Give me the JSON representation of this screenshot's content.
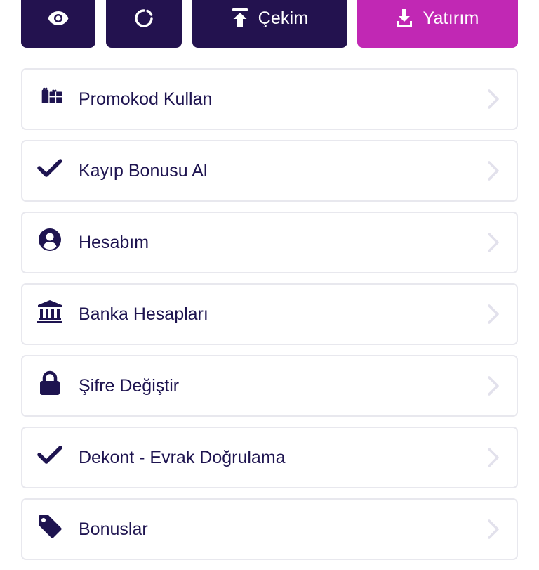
{
  "colors": {
    "dark_button": "#23124f",
    "accent_button": "#c128b4",
    "text": "#1e1450",
    "chevron": "#e2e1ec",
    "card_border": "#e8e8ee"
  },
  "toolbar": {
    "show_balance_icon": "eye-icon",
    "refresh_icon": "refresh-icon",
    "withdraw": {
      "icon": "upload-icon",
      "label": "Çekim"
    },
    "deposit": {
      "icon": "download-icon",
      "label": "Yatırım"
    }
  },
  "menu": {
    "items": [
      {
        "icon": "gift-icon",
        "label": "Promokod Kullan"
      },
      {
        "icon": "check-icon",
        "label": "Kayıp Bonusu Al"
      },
      {
        "icon": "user-circle-icon",
        "label": "Hesabım"
      },
      {
        "icon": "bank-icon",
        "label": "Banka Hesapları"
      },
      {
        "icon": "lock-icon",
        "label": "Şifre Değiştir"
      },
      {
        "icon": "check-icon",
        "label": "Dekont - Evrak Doğrulama"
      },
      {
        "icon": "tag-icon",
        "label": "Bonuslar"
      }
    ]
  }
}
